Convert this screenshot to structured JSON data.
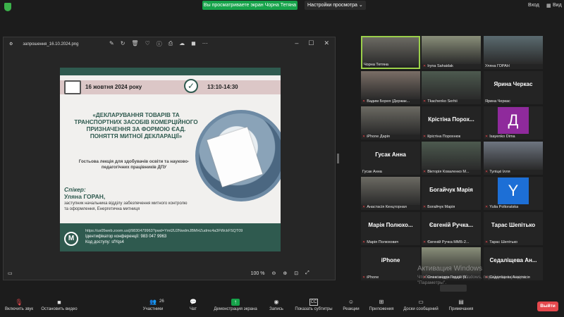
{
  "top": {
    "share_banner": "Вы просматриваете экран Чорна Тетяна",
    "view_options": "Настройки просмотра ⌄",
    "enter": "Вход",
    "view": "Вид"
  },
  "viewer": {
    "filename": "запрошення_16.10.2024.png",
    "zoom": "100 %"
  },
  "slide": {
    "date": "16 жовтня 2024 року",
    "time": "13:10-14:30",
    "title": "«ДЕКЛАРУВАННЯ ТОВАРІВ ТА ТРАНСПОРТНИХ ЗАСОБІВ КОМЕРЦІЙНОГО ПРИЗНАЧЕННЯ ЗА ФОРМОЮ ЄАД. ПОНЯТТЯ МИТНОЇ ДЕКЛАРАЦІЇ»",
    "subtitle": "Гостьова лекція для здобувачів освіти та науково-педагогічних працівників ДПУ",
    "speaker_label": "Спікер:",
    "speaker_name": "Уляна ГОРАН,",
    "speaker_role": "заступник начальника відділу забезпечення митного контролю та оформлення, Енергетична митниця",
    "link": "https://us05web.zoom.us/j/9830479963?pwd=Ymt2U2NwdmJBMHZudmc4a3FWckFSQT09",
    "conference_id": "Ідентифікатор конференції: 983 047 9963",
    "passcode": "Код доступу: sfYqs4"
  },
  "participants": [
    {
      "name": "Чорна Тетяна",
      "kind": "video",
      "active": true,
      "muted": false
    },
    {
      "name": "Iryna Sahaidak",
      "kind": "video",
      "muted": true
    },
    {
      "name": "Уляна ГОРАН",
      "kind": "video",
      "muted": false
    },
    {
      "name": "Вадим Борея (Держак...",
      "kind": "video",
      "muted": true
    },
    {
      "name": "Tkachenko Serhii",
      "kind": "video",
      "muted": true
    },
    {
      "name": "Ярина Черкас",
      "kind": "text",
      "big": "Ярина Черкас",
      "muted": false
    },
    {
      "name": "iPhone Дарія",
      "kind": "video",
      "muted": true
    },
    {
      "name": "Крістіна Порохнюк",
      "kind": "text",
      "big": "Крістіна Порох...",
      "muted": true
    },
    {
      "name": "Isayenko Dima",
      "kind": "letter",
      "letter": "Д",
      "color": "#8f2a9c",
      "muted": true
    },
    {
      "name": "Гусак Анна",
      "kind": "text",
      "big": "Гусак Анна",
      "muted": false
    },
    {
      "name": "Вікторія Коваленко М...",
      "kind": "video",
      "muted": true
    },
    {
      "name": "Туліцкі Ілля",
      "kind": "video",
      "muted": true
    },
    {
      "name": "Анастасія Кенцторная",
      "kind": "video",
      "muted": true
    },
    {
      "name": "Богайчук Марія",
      "kind": "text",
      "big": "Богайчук Марія",
      "muted": true
    },
    {
      "name": "Yulia Poltoratska",
      "kind": "letter",
      "letter": "Y",
      "color": "#1d6fd6",
      "muted": true
    },
    {
      "name": "Марія Полюхович",
      "kind": "text",
      "big": "Марія Полюхо...",
      "muted": true
    },
    {
      "name": "Євгеній Ручка ММБ-2...",
      "kind": "text",
      "big": "Євгеній Ручка...",
      "muted": true
    },
    {
      "name": "Тарас Шепітько",
      "kind": "text",
      "big": "Тарас Шепітько",
      "muted": true
    },
    {
      "name": "iPhone",
      "kind": "text",
      "big": "iPhone",
      "muted": true
    },
    {
      "name": "Олександра Гордій (К...",
      "kind": "video",
      "muted": true
    },
    {
      "name": "Седаліщева Анастасія",
      "kind": "text",
      "big": "Седаліщева Ан...",
      "muted": true
    }
  ],
  "watermark": {
    "line1": "Активация Windows",
    "line2": "Чтобы активировать Windows, перейдите в раздел \"Параметры\"."
  },
  "toolbar": {
    "mute": "Включить звук",
    "video": "Остановить видео",
    "participants": "Участники",
    "participants_count": "26",
    "chat": "Чат",
    "share": "Демонстрация экрана",
    "record": "Запись",
    "cc": "Показать субтитры",
    "reactions": "Реакции",
    "apps": "Приложения",
    "whiteboard": "Доски сообщений",
    "notes": "Примечания",
    "exit": "Выйти"
  },
  "colors": {
    "share_green": "#16a34a",
    "slide_teal": "#2f5a4f",
    "exit_red": "#e5484d",
    "active_border": "#9bd04a"
  }
}
